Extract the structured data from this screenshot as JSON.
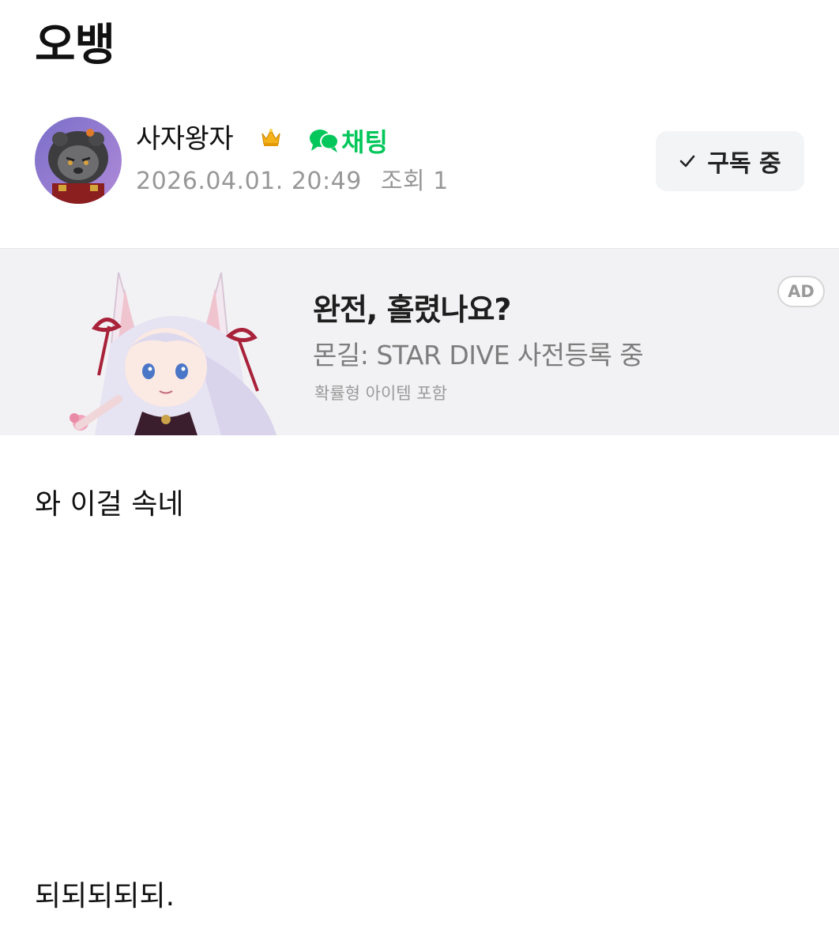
{
  "post": {
    "title": "오뱅",
    "body_lines": [
      "와 이걸 속네",
      "되되되되되."
    ]
  },
  "author": {
    "name": "사자왕자",
    "chat_label": "채팅",
    "date": "2026.04.01. 20:49",
    "views": "조회 1",
    "avatar_icon": "lion-character-avatar",
    "badge_icon": "crown-icon"
  },
  "subscribe": {
    "label": "구독 중",
    "icon": "check-icon"
  },
  "ad": {
    "headline": "완전, 홀렸나요?",
    "sub": "몬길: STAR DIVE 사전등록 중",
    "note": "확률형 아이템 포함",
    "badge": "AD"
  },
  "colors": {
    "accent_green": "#03c75a",
    "meta_gray": "#979797",
    "ad_bg": "#f2f2f4",
    "button_bg": "#f3f4f6"
  }
}
